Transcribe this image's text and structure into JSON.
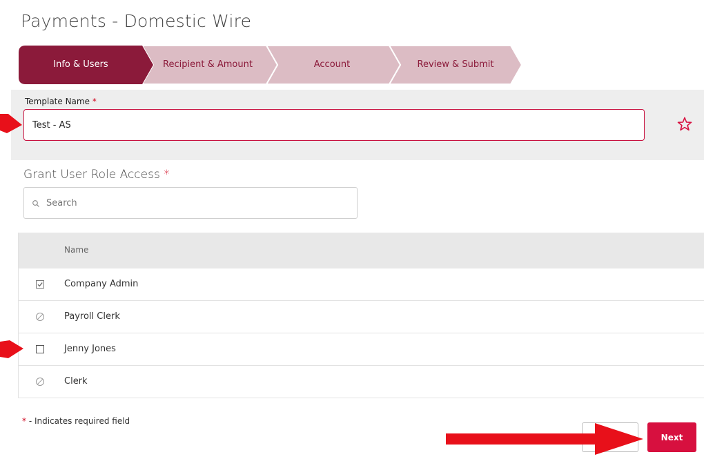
{
  "page": {
    "title": "Payments - Domestic Wire"
  },
  "wizard": {
    "steps": [
      {
        "label": "Info & Users",
        "state": "active"
      },
      {
        "label": "Recipient & Amount",
        "state": "inactive"
      },
      {
        "label": "Account",
        "state": "inactive"
      },
      {
        "label": "Review & Submit",
        "state": "inactive"
      }
    ]
  },
  "template": {
    "label": "Template Name",
    "required_marker": "*",
    "value": "Test - AS",
    "favorite_icon": "star-outline-icon"
  },
  "access": {
    "title": "Grant User Role Access",
    "required_marker": "*",
    "search_placeholder": "Search",
    "column_name": "Name",
    "rows": [
      {
        "name": "Company Admin",
        "state": "checked",
        "icon": "checkbox-checked-icon"
      },
      {
        "name": "Payroll Clerk",
        "state": "disabled",
        "icon": "disabled-circle-icon"
      },
      {
        "name": "Jenny Jones",
        "state": "unchecked",
        "icon": "checkbox-empty-icon"
      },
      {
        "name": "Clerk",
        "state": "disabled",
        "icon": "disabled-circle-icon"
      }
    ]
  },
  "footer": {
    "required_marker": "*",
    "required_note": " - Indicates required field",
    "back_label": "",
    "next_label": "Next"
  },
  "colors": {
    "active_step": "#8b1a3a",
    "inactive_step": "#dcbcc4",
    "accent": "#d7103f",
    "annotation_arrow": "#e8101a"
  }
}
